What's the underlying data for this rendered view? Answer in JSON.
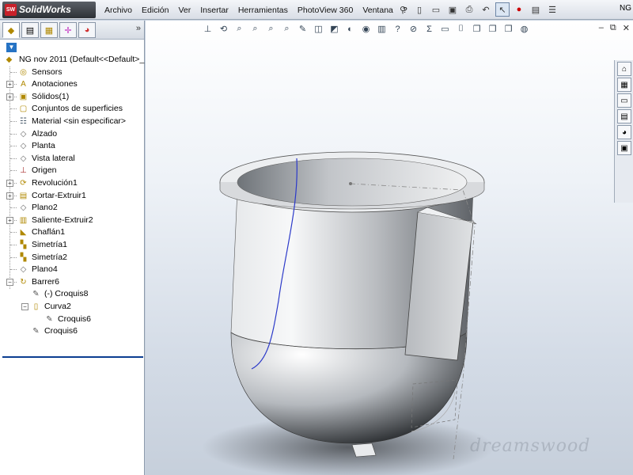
{
  "app": {
    "brand": "SolidWorks",
    "brand_mark": "SW"
  },
  "menu": [
    "Archivo",
    "Edición",
    "Ver",
    "Insertar",
    "Herramientas",
    "PhotoView 360",
    "Ventana",
    "?"
  ],
  "window_label": "NG",
  "tree": {
    "root": "NG nov 2011  (Default<<Default>_",
    "items": [
      {
        "label": "Sensors",
        "icon": "sensors-icon",
        "expand": false
      },
      {
        "label": "Anotaciones",
        "icon": "annotations-icon",
        "expand": true
      },
      {
        "label": "Sólidos(1)",
        "icon": "solid-bodies-icon",
        "expand": true
      },
      {
        "label": "Conjuntos de superficies",
        "icon": "surface-bodies-icon",
        "expand": false
      },
      {
        "label": "Material <sin especificar>",
        "icon": "material-icon",
        "expand": false
      },
      {
        "label": "Alzado",
        "icon": "plane-icon",
        "expand": false
      },
      {
        "label": "Planta",
        "icon": "plane-icon",
        "expand": false
      },
      {
        "label": "Vista lateral",
        "icon": "plane-icon",
        "expand": false
      },
      {
        "label": "Origen",
        "icon": "origin-icon",
        "expand": false
      },
      {
        "label": "Revolución1",
        "icon": "revolve-icon",
        "expand": true
      },
      {
        "label": "Cortar-Extruir1",
        "icon": "cut-extrude-icon",
        "expand": true
      },
      {
        "label": "Plano2",
        "icon": "plane-icon",
        "expand": false
      },
      {
        "label": "Saliente-Extruir2",
        "icon": "boss-extrude-icon",
        "expand": true
      },
      {
        "label": "Chaflán1",
        "icon": "chamfer-icon",
        "expand": false
      },
      {
        "label": "Simetría1",
        "icon": "mirror-icon",
        "expand": false
      },
      {
        "label": "Simetría2",
        "icon": "mirror-icon",
        "expand": false
      },
      {
        "label": "Plano4",
        "icon": "plane-icon",
        "expand": false
      },
      {
        "label": "Barrer6",
        "icon": "sweep-icon",
        "expand": true,
        "open": true
      }
    ],
    "children": [
      {
        "label": "(-) Croquis8",
        "icon": "sketch-icon"
      },
      {
        "label": "Curva2",
        "icon": "curve-icon"
      },
      {
        "label": "Croquis6",
        "icon": "sketch-icon"
      },
      {
        "label": "Croquis6",
        "icon": "sketch-icon"
      }
    ]
  },
  "watermark": "dreamswood",
  "colors": {
    "accent": "#2673c4",
    "rollback": "#0b3d91",
    "sketch_line": "#2b39c9"
  }
}
